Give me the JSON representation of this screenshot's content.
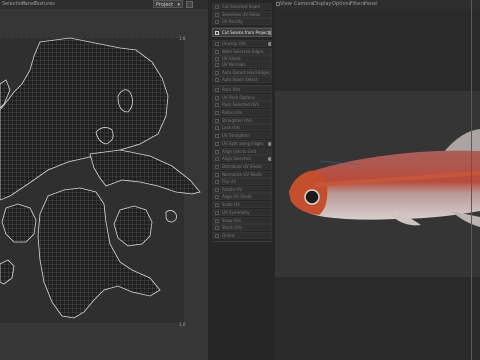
{
  "uv_editor": {
    "menu": [
      "Selection",
      "Panel",
      "Textures"
    ],
    "view_select": "Project",
    "corner_top_right": "1,0",
    "corner_bottom_right": "1,0"
  },
  "tools": {
    "group1": [
      "Cut Selected Seam",
      "Seamless UV Relax",
      "UV Rectify"
    ],
    "active": "Cut Seams from Projection",
    "group2": [
      "Unwrap UVs",
      "Weld Selected Edges",
      "UV Shells"
    ],
    "group3": [
      "UV Normals",
      "Auto Detect Hard Edges",
      "Auto Seam Select"
    ],
    "group4": [
      "Pack UVs",
      "UV Pack Options",
      "Pack Selected UVs"
    ],
    "group5": [
      "Relax UVs",
      "Straighten UVs",
      "Lock UVs",
      "UV Straighten",
      "UV Split along Edges",
      "Align UVs to Grid",
      "Align Selected",
      "Distribute UV Shells",
      "Normalize UV Shells"
    ],
    "group6": [
      "Flip UV",
      "Rotate UV",
      "Align UV Shells",
      "Scale UV",
      "UV Symmetry",
      "Snap UVs",
      "Stack UVs",
      "Orient"
    ]
  },
  "viewport": {
    "menu": [
      "View",
      "Camera",
      "Display",
      "Options",
      "Filters",
      "Panel"
    ]
  },
  "colors": {
    "accent": "#e2e2e2",
    "uv_fill": "#1f1f1f",
    "uv_wire": "#9a9a9a"
  }
}
